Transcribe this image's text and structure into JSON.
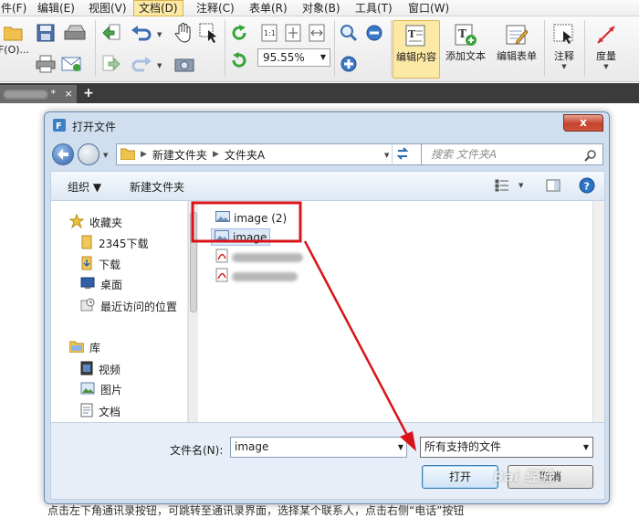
{
  "menubar": {
    "items": [
      {
        "label": "件(F)"
      },
      {
        "label": "编辑(E)"
      },
      {
        "label": "视图(V)"
      },
      {
        "label": "文档(D)"
      },
      {
        "label": "注释(C)"
      },
      {
        "label": "表单(R)"
      },
      {
        "label": "对象(B)"
      },
      {
        "label": "工具(T)"
      },
      {
        "label": "窗口(W)"
      }
    ],
    "active_index": 3
  },
  "toolbar": {
    "open_partial_label": "F(O)...",
    "zoom_value": "95.55%",
    "edit_content_label": "编辑内容",
    "add_text_label": "添加文本",
    "edit_form_label": "编辑表单",
    "annotate_label": "注释",
    "measure_label": "度量"
  },
  "tabs": {
    "doc_tab_suffix": "*",
    "close_glyph": "×",
    "new_tab_glyph": "+"
  },
  "dialog": {
    "title": "打开文件",
    "close_glyph": "x",
    "breadcrumb": [
      "新建文件夹",
      "文件夹A"
    ],
    "search_placeholder": "搜索 文件夹A",
    "commands": {
      "organize": "组织 ▼",
      "new_folder": "新建文件夹"
    },
    "nav": {
      "favorites": "收藏夹",
      "fav_items": [
        "2345下载",
        "下载",
        "桌面",
        "最近访问的位置"
      ],
      "libraries": "库",
      "lib_items": [
        "视频",
        "图片",
        "文档"
      ]
    },
    "files": [
      {
        "name": "image (2)",
        "type": "image",
        "selected": false
      },
      {
        "name": "image",
        "type": "image",
        "selected": true
      },
      {
        "name": "",
        "type": "pdf",
        "selected": false
      },
      {
        "name": "",
        "type": "pdf",
        "selected": false
      }
    ],
    "filename_label": "文件名(N):",
    "filename_value": "image",
    "filetype_value": "所有支持的文件",
    "open_button": "打开",
    "cancel_button": "取消"
  },
  "colors": {
    "annotation_red": "#d8141a",
    "active_menu": "#fde9a6",
    "dialog_frame": "#cfdff0"
  },
  "watermark": "Bai 经验",
  "bottom_text": "点击左下角通讯录按钮，可跳转至通讯录界面，选择某个联系人，点击右侧“电话”按钮"
}
